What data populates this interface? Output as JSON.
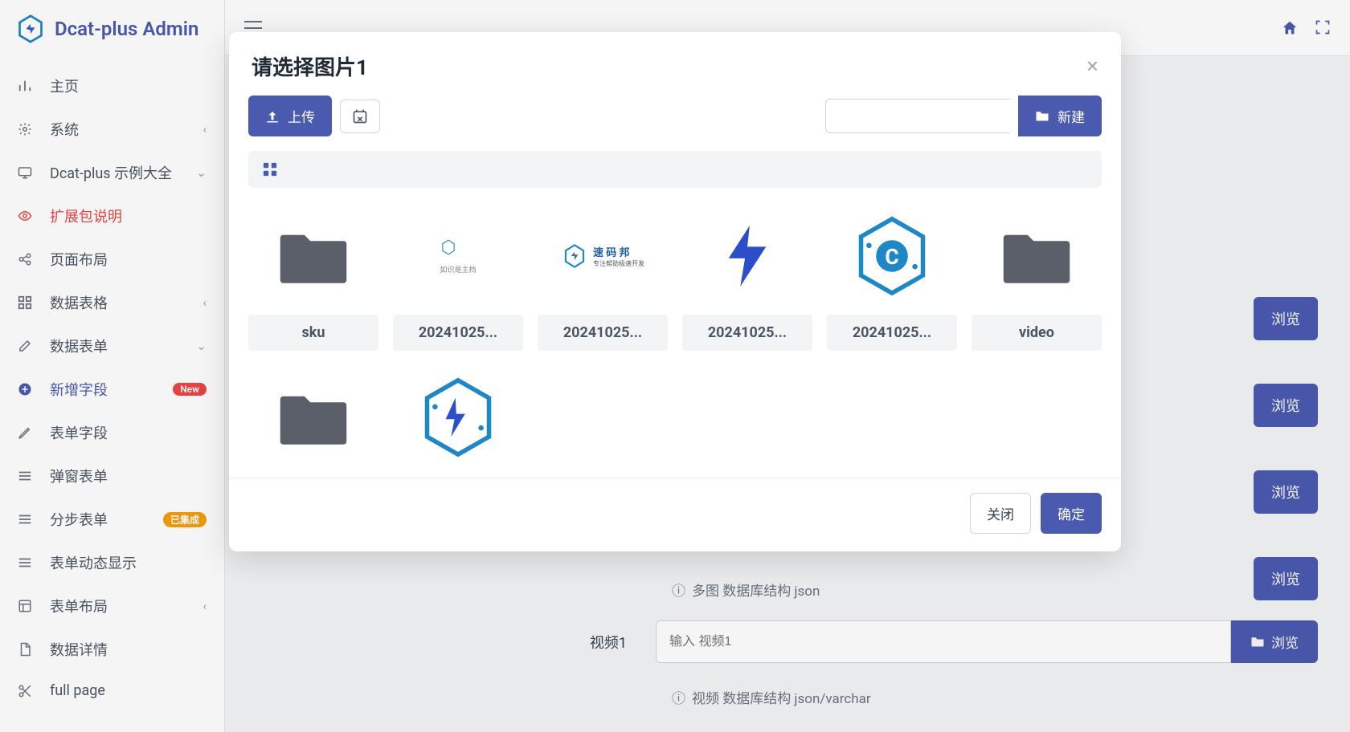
{
  "brand": "Dcat-plus Admin",
  "sidebar": {
    "items": [
      {
        "icon": "bar-chart",
        "label": "主页"
      },
      {
        "icon": "gear",
        "label": "系统",
        "chevron": "left"
      },
      {
        "icon": "monitor",
        "label": "Dcat-plus 示例大全",
        "chevron": "down"
      },
      {
        "icon": "eye",
        "label": "扩展包说明",
        "highlight": true
      },
      {
        "icon": "share",
        "label": "页面布局"
      },
      {
        "icon": "grid",
        "label": "数据表格",
        "chevron": "left"
      },
      {
        "icon": "edit",
        "label": "数据表单",
        "chevron": "down"
      },
      {
        "icon": "plus-circle",
        "label": "新增字段",
        "active": true,
        "badge": "New",
        "badge_color": "red"
      },
      {
        "icon": "pencil",
        "label": "表单字段"
      },
      {
        "icon": "menu",
        "label": "弹窗表单"
      },
      {
        "icon": "menu",
        "label": "分步表单",
        "badge": "已集成",
        "badge_color": "orange"
      },
      {
        "icon": "menu",
        "label": "表单动态显示"
      },
      {
        "icon": "layout",
        "label": "表单布局",
        "chevron": "left"
      },
      {
        "icon": "file",
        "label": "数据详情"
      },
      {
        "icon": "scissors",
        "label": "full page"
      }
    ]
  },
  "content": {
    "hint1": "多图 数据库结构 json",
    "field2_label": "视频1",
    "field2_placeholder": "输入 视频1",
    "hint2": "视频 数据库结构 json/varchar",
    "browse": "浏览"
  },
  "modal": {
    "title": "请选择图片1",
    "upload": "上传",
    "new": "新建",
    "close": "关闭",
    "confirm": "确定",
    "files": [
      {
        "type": "folder",
        "name": "sku"
      },
      {
        "type": "image",
        "name": "20241025...",
        "thumb": "doc"
      },
      {
        "type": "image",
        "name": "20241025...",
        "thumb": "sumabang"
      },
      {
        "type": "image",
        "name": "20241025...",
        "thumb": "bolt"
      },
      {
        "type": "image",
        "name": "20241025...",
        "thumb": "hexc"
      },
      {
        "type": "folder",
        "name": "video"
      },
      {
        "type": "folder",
        "name": ""
      },
      {
        "type": "image",
        "name": "",
        "thumb": "hexbolt"
      }
    ]
  }
}
